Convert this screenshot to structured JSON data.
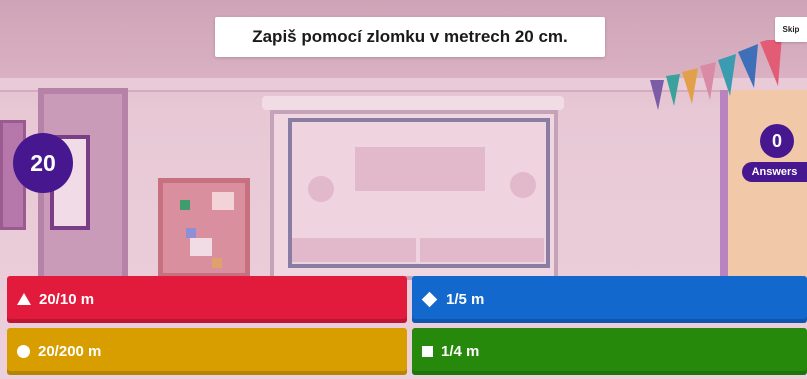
{
  "question": {
    "text": "Zapiš pomocí zlomku v metrech 20 cm."
  },
  "skip": {
    "label": "Skip"
  },
  "timer": {
    "value": "20"
  },
  "answers_counter": {
    "count": "0",
    "label": "Answers"
  },
  "answers": [
    {
      "shape": "triangle-icon",
      "label": "20/10 m",
      "color": "#e21b3c"
    },
    {
      "shape": "diamond-icon",
      "label": "1/5 m",
      "color": "#1368ce"
    },
    {
      "shape": "circle-icon",
      "label": "20/200 m",
      "color": "#d89e00"
    },
    {
      "shape": "square-icon",
      "label": "1/4 m",
      "color": "#26890c"
    }
  ],
  "colors": {
    "accent_purple": "#46178f",
    "red": "#e21b3c",
    "blue": "#1368ce",
    "yellow": "#d89e00",
    "green": "#26890c"
  }
}
